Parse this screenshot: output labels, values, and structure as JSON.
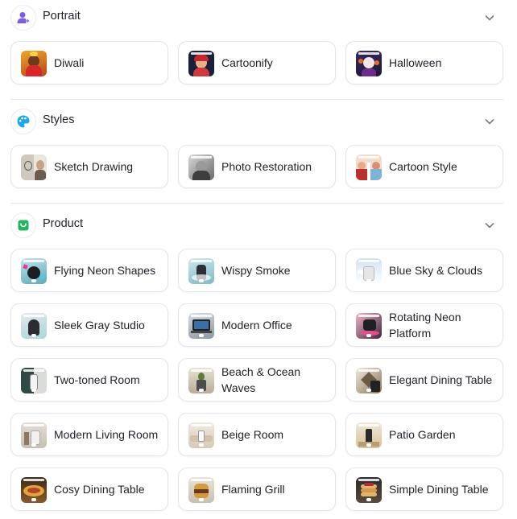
{
  "sections": {
    "portrait": {
      "title": "Portrait",
      "icon": "user-sparkle-icon",
      "items": [
        {
          "label": "Diwali",
          "thumb": "diwali-thumbnail"
        },
        {
          "label": "Cartoonify",
          "thumb": "cartoonify-thumbnail"
        },
        {
          "label": "Halloween",
          "thumb": "halloween-thumbnail"
        }
      ]
    },
    "styles": {
      "title": "Styles",
      "icon": "palette-icon",
      "items": [
        {
          "label": "Sketch Drawing",
          "thumb": "sketch-thumbnail"
        },
        {
          "label": "Photo Restoration",
          "thumb": "photo-restoration-thumbnail"
        },
        {
          "label": "Cartoon Style",
          "thumb": "cartoon-style-thumbnail"
        }
      ]
    },
    "product": {
      "title": "Product",
      "icon": "shopping-bag-icon",
      "items": [
        {
          "label": "Flying Neon Shapes"
        },
        {
          "label": "Wispy Smoke"
        },
        {
          "label": "Blue Sky & Clouds"
        },
        {
          "label": "Sleek Gray Studio"
        },
        {
          "label": "Modern Office"
        },
        {
          "label": "Rotating Neon Platform"
        },
        {
          "label": "Two-toned Room"
        },
        {
          "label": "Beach & Ocean Waves"
        },
        {
          "label": "Elegant Dining Table"
        },
        {
          "label": "Modern Living Room"
        },
        {
          "label": "Beige Room"
        },
        {
          "label": "Patio Garden"
        },
        {
          "label": "Cosy Dining Table"
        },
        {
          "label": "Flaming Grill"
        },
        {
          "label": "Simple Dining Table"
        }
      ]
    }
  },
  "colors": {
    "portrait_icon": "#7b5cf0",
    "styles_icon": "#1fa8e8",
    "product_icon": "#22b35e",
    "chevron": "#7a7a88"
  }
}
